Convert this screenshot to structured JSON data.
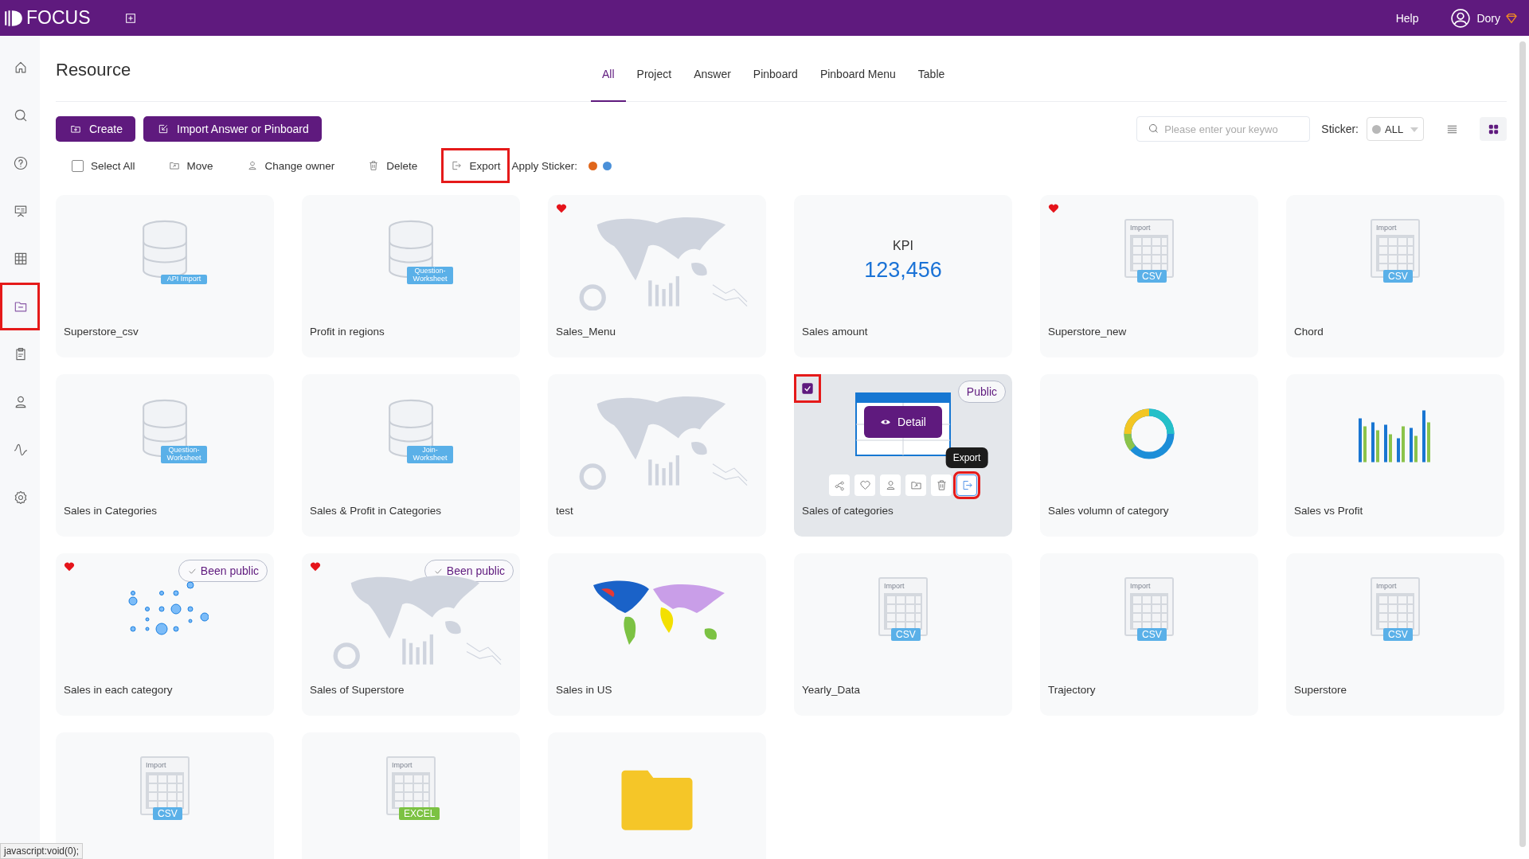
{
  "topbar": {
    "logo": "FOCUS",
    "help": "Help",
    "user": "Dory"
  },
  "sidebar": {
    "items": [
      {
        "kind": "home",
        "selected": false,
        "highlighted": false
      },
      {
        "kind": "search",
        "selected": false,
        "highlighted": false
      },
      {
        "kind": "help",
        "selected": false,
        "highlighted": false
      },
      {
        "kind": "board",
        "selected": false,
        "highlighted": false
      },
      {
        "kind": "grid",
        "selected": false,
        "highlighted": false
      },
      {
        "kind": "folder",
        "selected": true,
        "highlighted": true
      },
      {
        "kind": "clipboard",
        "selected": false,
        "highlighted": false
      },
      {
        "kind": "user",
        "selected": false,
        "highlighted": false
      },
      {
        "kind": "pulse",
        "selected": false,
        "highlighted": false
      },
      {
        "kind": "gear",
        "selected": false,
        "highlighted": false
      }
    ]
  },
  "page": {
    "title": "Resource"
  },
  "tabs": [
    {
      "label": "All",
      "selected": true
    },
    {
      "label": "Project",
      "selected": false
    },
    {
      "label": "Answer",
      "selected": false
    },
    {
      "label": "Pinboard",
      "selected": false
    },
    {
      "label": "Pinboard Menu",
      "selected": false
    },
    {
      "label": "Table",
      "selected": false
    }
  ],
  "buttons": [
    {
      "kind": "create",
      "label": "Create"
    },
    {
      "kind": "import",
      "label": "Import Answer or Pinboard"
    }
  ],
  "search": {
    "placeholder": "Please enter your keywo"
  },
  "sticker_filter": {
    "label": "Sticker:",
    "value": "ALL"
  },
  "view_toggle": [
    {
      "kind": "list",
      "selected": false
    },
    {
      "kind": "grid",
      "selected": true
    }
  ],
  "select_all": {
    "label": "Select All",
    "checked": false
  },
  "actions": [
    {
      "kind": "move",
      "label": "Move",
      "highlighted": false
    },
    {
      "kind": "owner",
      "label": "Change owner",
      "highlighted": false
    },
    {
      "kind": "delete",
      "label": "Delete",
      "highlighted": false
    },
    {
      "kind": "export",
      "label": "Export",
      "highlighted": true
    }
  ],
  "apply_sticker": {
    "label": "Apply Sticker:",
    "stickers": [
      {
        "color": "#e0661b"
      },
      {
        "color": "#4a90d9"
      }
    ]
  },
  "cards": [
    {
      "name": "Superstore_csv",
      "kind": "database",
      "badge": {
        "text": "API Import",
        "color": "#5ab0e8"
      },
      "favorite": false,
      "selected": false
    },
    {
      "name": "Profit in regions",
      "kind": "database",
      "badge": {
        "text": "Question-Worksheet",
        "color": "#5ab0e8"
      },
      "favorite": false,
      "selected": false
    },
    {
      "name": "Sales_Menu",
      "kind": "dashboard",
      "favorite": true,
      "selected": false
    },
    {
      "name": "Sales amount",
      "kind": "kpi",
      "kpi_label": "KPI",
      "kpi_value": "123,456",
      "favorite": false,
      "selected": false
    },
    {
      "name": "Superstore_new",
      "kind": "import",
      "import_label": "Import",
      "badge": {
        "text": "CSV",
        "color": "#5ab0e8"
      },
      "favorite": true,
      "selected": false
    },
    {
      "name": "Chord",
      "kind": "import",
      "import_label": "Import",
      "badge": {
        "text": "CSV",
        "color": "#5ab0e8"
      },
      "favorite": false,
      "selected": false
    },
    {
      "name": "Sales in Categories",
      "kind": "database",
      "badge": {
        "text": "Question-Worksheet",
        "color": "#5ab0e8"
      },
      "favorite": false,
      "selected": false
    },
    {
      "name": "Sales & Profit in Categories",
      "kind": "database",
      "badge": {
        "text": "Join-Worksheet",
        "color": "#5ab0e8"
      },
      "favorite": false,
      "selected": false
    },
    {
      "name": "test",
      "kind": "dashboard",
      "favorite": false,
      "selected": false
    },
    {
      "name": "Sales of categories",
      "kind": "table",
      "favorite": false,
      "selected": true,
      "public": "Public",
      "detail": "Detail",
      "tooltip": "Export",
      "card_actions": [
        {
          "kind": "share",
          "highlighted": false
        },
        {
          "kind": "heart",
          "highlighted": false
        },
        {
          "kind": "user",
          "highlighted": false
        },
        {
          "kind": "move",
          "highlighted": false
        },
        {
          "kind": "delete",
          "highlighted": false
        },
        {
          "kind": "export",
          "highlighted": true
        }
      ]
    },
    {
      "name": "Sales volumn of category",
      "kind": "donut",
      "favorite": false,
      "selected": false
    },
    {
      "name": "Sales vs Profit",
      "kind": "bars",
      "favorite": false,
      "selected": false
    },
    {
      "name": "Sales in each category",
      "kind": "dots",
      "favorite": true,
      "selected": false,
      "public": "Been public"
    },
    {
      "name": "Sales of Superstore",
      "kind": "dashboard",
      "favorite": true,
      "selected": false,
      "public": "Been public"
    },
    {
      "name": "Sales in US",
      "kind": "usmap",
      "favorite": false,
      "selected": false
    },
    {
      "name": "Yearly_Data",
      "kind": "import",
      "import_label": "Import",
      "badge": {
        "text": "CSV",
        "color": "#5ab0e8"
      },
      "favorite": false,
      "selected": false
    },
    {
      "name": "Trajectory",
      "kind": "import",
      "import_label": "Import",
      "badge": {
        "text": "CSV",
        "color": "#5ab0e8"
      },
      "favorite": false,
      "selected": false
    },
    {
      "name": "Superstore",
      "kind": "import",
      "import_label": "Import",
      "badge": {
        "text": "CSV",
        "color": "#5ab0e8"
      },
      "favorite": false,
      "selected": false
    },
    {
      "kind": "import",
      "import_label": "Import",
      "badge": {
        "text": "CSV",
        "color": "#5ab0e8"
      },
      "favorite": false,
      "selected": false
    },
    {
      "kind": "import",
      "import_label": "Import",
      "badge": {
        "text": "EXCEL",
        "color": "#7cc243"
      },
      "favorite": false,
      "selected": false
    },
    {
      "kind": "folder",
      "favorite": false,
      "selected": false
    }
  ],
  "status_bar": {
    "text": "javascript:void(0);"
  }
}
